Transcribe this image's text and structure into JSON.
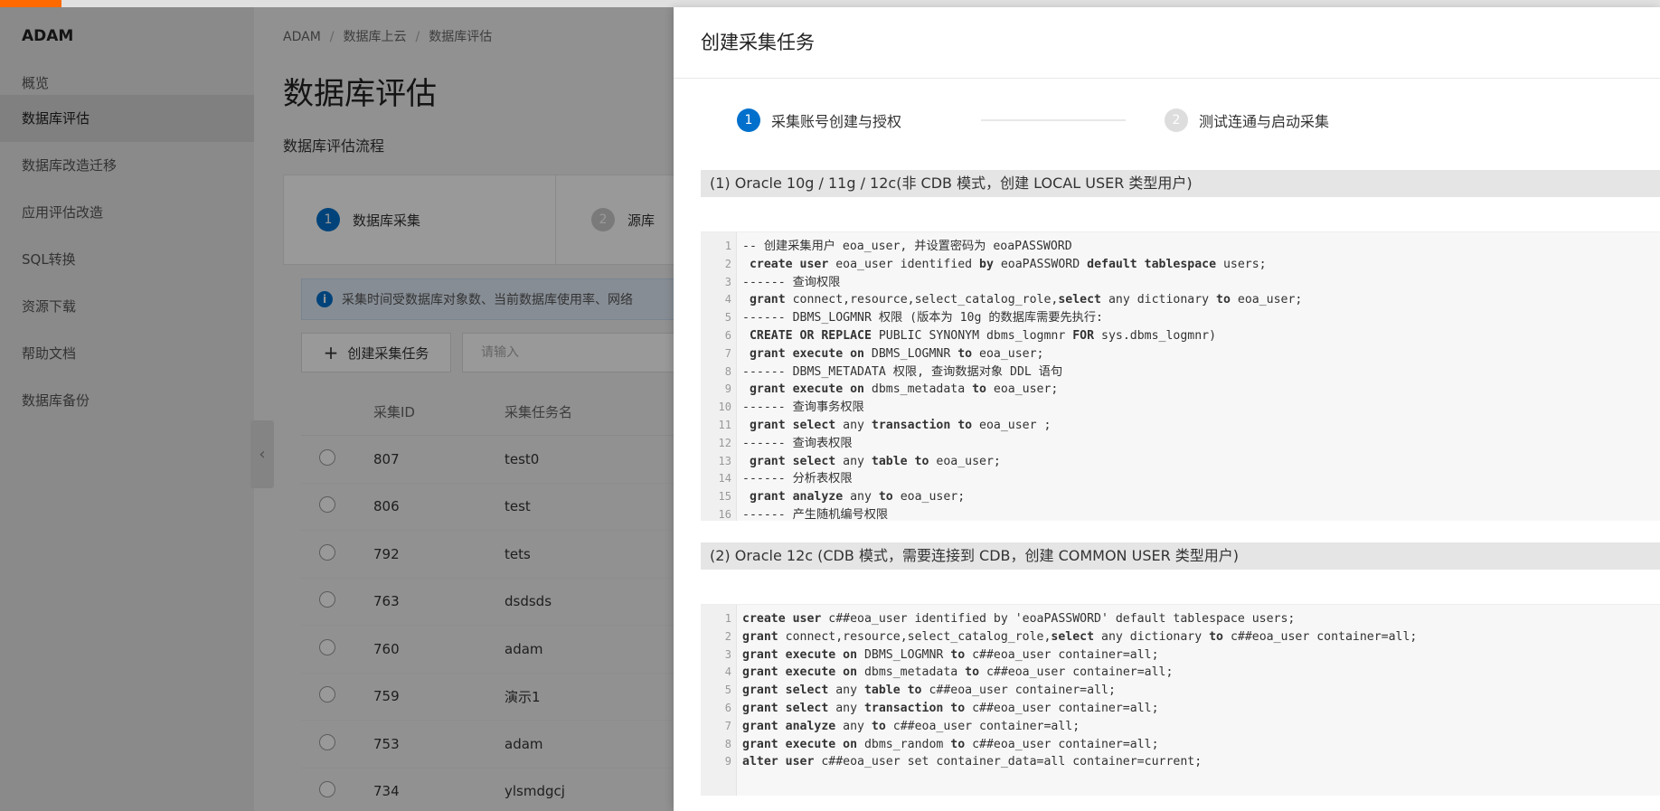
{
  "sidebar": {
    "brand": "ADAM",
    "items": [
      {
        "label": "概览"
      },
      {
        "label": "数据库评估",
        "active": true
      },
      {
        "label": "数据库改造迁移"
      },
      {
        "label": "应用评估改造"
      },
      {
        "label": "SQL转换"
      },
      {
        "label": "资源下载"
      },
      {
        "label": "帮助文档"
      },
      {
        "label": "数据库备份"
      }
    ]
  },
  "main": {
    "breadcrumb": [
      "ADAM",
      "数据库上云",
      "数据库评估"
    ],
    "title": "数据库评估",
    "flow_title": "数据库评估流程",
    "flow_steps": [
      {
        "num": "1",
        "label": "数据库采集"
      },
      {
        "num": "2",
        "label": "源库"
      }
    ],
    "info_text": "采集时间受数据库对象数、当前数据库使用率、网络",
    "create_button": "创建采集任务",
    "search_placeholder": "请输入",
    "table": {
      "columns": [
        "采集ID",
        "采集任务名"
      ],
      "rows": [
        {
          "id": "807",
          "name": "test0"
        },
        {
          "id": "806",
          "name": "test"
        },
        {
          "id": "792",
          "name": "tets"
        },
        {
          "id": "763",
          "name": "dsdsds"
        },
        {
          "id": "760",
          "name": "adam"
        },
        {
          "id": "759",
          "name": "演示1"
        },
        {
          "id": "753",
          "name": "adam"
        },
        {
          "id": "734",
          "name": "ylsmdgcj"
        }
      ]
    }
  },
  "drawer": {
    "title": "创建采集任务",
    "steps": [
      {
        "num": "1",
        "label": "采集账号创建与授权",
        "active": true
      },
      {
        "num": "2",
        "label": "测试连通与启动采集",
        "active": false
      }
    ],
    "section1": {
      "header": "(1) Oracle 10g / 11g / 12c(非 CDB 模式，创建 LOCAL USER 类型用户)",
      "lines": [
        {
          "n": "1",
          "segs": [
            {
              "t": "-- 创建采集用户 eoa_user, 并设置密码为 eoaPASSWORD",
              "c": "comment"
            }
          ]
        },
        {
          "n": "2",
          "segs": [
            {
              "t": " create user",
              "c": "kw"
            },
            {
              "t": " eoa_user identified ",
              "c": ""
            },
            {
              "t": "by",
              "c": "kw"
            },
            {
              "t": " eoaPASSWORD ",
              "c": ""
            },
            {
              "t": "default tablespace",
              "c": "kw"
            },
            {
              "t": " users;",
              "c": ""
            }
          ]
        },
        {
          "n": "3",
          "segs": [
            {
              "t": "------ 查询权限",
              "c": ""
            }
          ]
        },
        {
          "n": "4",
          "segs": [
            {
              "t": " grant",
              "c": "kw"
            },
            {
              "t": " connect",
              "c": "org"
            },
            {
              "t": ",resource,select_catalog_role,",
              "c": ""
            },
            {
              "t": "select",
              "c": "kw"
            },
            {
              "t": " any dictionary ",
              "c": ""
            },
            {
              "t": "to",
              "c": "kw"
            },
            {
              "t": " eoa_user;",
              "c": ""
            }
          ]
        },
        {
          "n": "5",
          "segs": [
            {
              "t": "------ DBMS_LOGMNR 权限 (版本为 10g 的数据库需要先执行:",
              "c": ""
            }
          ]
        },
        {
          "n": "6",
          "segs": [
            {
              "t": " CREATE OR REPLACE",
              "c": "kw"
            },
            {
              "t": " PUBLIC SYNONYM dbms_logmnr ",
              "c": ""
            },
            {
              "t": "FOR",
              "c": "kw"
            },
            {
              "t": " sys.",
              "c": ""
            },
            {
              "t": "dbms_logmnr",
              "c": "blue"
            },
            {
              "t": ")",
              "c": ""
            }
          ]
        },
        {
          "n": "7",
          "segs": [
            {
              "t": " grant execute on",
              "c": "kw"
            },
            {
              "t": " DBMS_LOGMNR ",
              "c": ""
            },
            {
              "t": "to",
              "c": "kw"
            },
            {
              "t": " eoa_user;",
              "c": ""
            }
          ]
        },
        {
          "n": "8",
          "segs": [
            {
              "t": "------ DBMS_METADATA 权限, 查询数据对象 DDL 语句",
              "c": ""
            }
          ]
        },
        {
          "n": "9",
          "segs": [
            {
              "t": " grant execute on",
              "c": "kw"
            },
            {
              "t": " dbms_metadata ",
              "c": ""
            },
            {
              "t": "to",
              "c": "kw"
            },
            {
              "t": " eoa_user;",
              "c": ""
            }
          ]
        },
        {
          "n": "10",
          "segs": [
            {
              "t": "------ 查询事务权限",
              "c": ""
            }
          ]
        },
        {
          "n": "11",
          "segs": [
            {
              "t": " grant select",
              "c": "kw"
            },
            {
              "t": " any ",
              "c": ""
            },
            {
              "t": "transaction to",
              "c": "kw"
            },
            {
              "t": " eoa_user ;",
              "c": ""
            }
          ]
        },
        {
          "n": "12",
          "segs": [
            {
              "t": "------ 查询表权限",
              "c": ""
            }
          ]
        },
        {
          "n": "13",
          "segs": [
            {
              "t": " grant select",
              "c": "kw"
            },
            {
              "t": " any ",
              "c": ""
            },
            {
              "t": "table to",
              "c": "kw"
            },
            {
              "t": " eoa_user;",
              "c": ""
            }
          ]
        },
        {
          "n": "14",
          "segs": [
            {
              "t": "------ 分析表权限",
              "c": ""
            }
          ]
        },
        {
          "n": "15",
          "segs": [
            {
              "t": " grant analyze",
              "c": "kw"
            },
            {
              "t": " any ",
              "c": ""
            },
            {
              "t": "to",
              "c": "kw"
            },
            {
              "t": " eoa_user;",
              "c": ""
            }
          ]
        },
        {
          "n": "16",
          "segs": [
            {
              "t": "------ 产生随机编号权限",
              "c": ""
            }
          ]
        }
      ]
    },
    "section2": {
      "header": "(2) Oracle 12c (CDB 模式，需要连接到 CDB，创建 COMMON USER 类型用户)",
      "lines": [
        {
          "n": "1",
          "segs": [
            {
              "t": "create user",
              "c": "kw"
            },
            {
              "t": " c##eoa_user identified by 'eoaPASSWORD' default tablespace users;",
              "c": "green"
            }
          ]
        },
        {
          "n": "2",
          "segs": [
            {
              "t": "grant",
              "c": "kw"
            },
            {
              "t": " connect",
              "c": "org"
            },
            {
              "t": ",resource,select_catalog_role,",
              "c": ""
            },
            {
              "t": "select",
              "c": "kw"
            },
            {
              "t": " any dictionary ",
              "c": ""
            },
            {
              "t": "to",
              "c": "kw"
            },
            {
              "t": " c##eoa_user container=all;",
              "c": "green"
            }
          ]
        },
        {
          "n": "3",
          "segs": [
            {
              "t": "grant execute on",
              "c": "kw"
            },
            {
              "t": " DBMS_LOGMNR ",
              "c": ""
            },
            {
              "t": "to",
              "c": "kw"
            },
            {
              "t": " c##eoa_user container=all;",
              "c": "green"
            }
          ]
        },
        {
          "n": "4",
          "segs": [
            {
              "t": "grant execute on",
              "c": "kw"
            },
            {
              "t": " dbms_metadata ",
              "c": ""
            },
            {
              "t": "to",
              "c": "kw"
            },
            {
              "t": " c##eoa_user container=all;",
              "c": "green"
            }
          ]
        },
        {
          "n": "5",
          "segs": [
            {
              "t": "grant select",
              "c": "kw"
            },
            {
              "t": " any ",
              "c": ""
            },
            {
              "t": "table to",
              "c": "kw"
            },
            {
              "t": " c##eoa_user container=all;",
              "c": "green"
            }
          ]
        },
        {
          "n": "6",
          "segs": [
            {
              "t": "grant select",
              "c": "kw"
            },
            {
              "t": " any ",
              "c": ""
            },
            {
              "t": "transaction to",
              "c": "kw"
            },
            {
              "t": " c##eoa_user container=all;",
              "c": "green"
            }
          ]
        },
        {
          "n": "7",
          "segs": [
            {
              "t": "grant analyze",
              "c": "kw"
            },
            {
              "t": " any ",
              "c": ""
            },
            {
              "t": "to",
              "c": "kw"
            },
            {
              "t": " c##eoa_user container=all;",
              "c": "green"
            }
          ]
        },
        {
          "n": "8",
          "segs": [
            {
              "t": "grant execute on",
              "c": "kw"
            },
            {
              "t": " dbms_random ",
              "c": ""
            },
            {
              "t": "to",
              "c": "kw"
            },
            {
              "t": " c##eoa_user container=all;",
              "c": "green"
            }
          ]
        },
        {
          "n": "9",
          "segs": [
            {
              "t": "alter user",
              "c": "kw"
            },
            {
              "t": " c##eoa_user set container_data=all container=current;",
              "c": "green"
            }
          ]
        }
      ]
    }
  }
}
